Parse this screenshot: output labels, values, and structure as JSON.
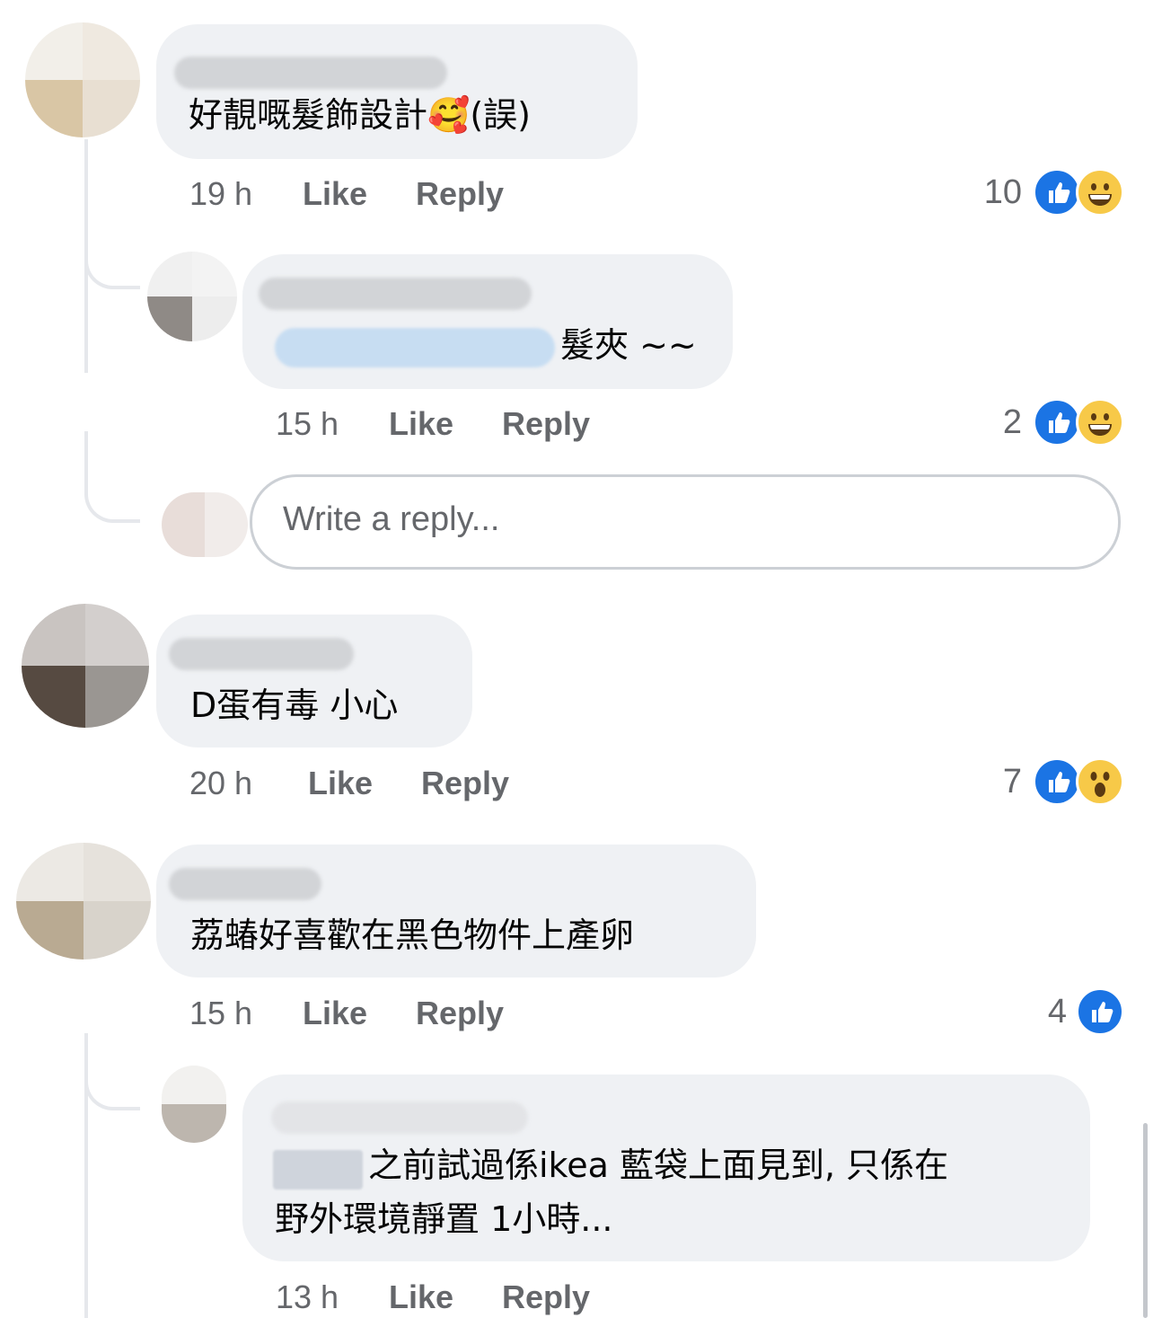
{
  "comments": [
    {
      "text": "好靚嘅髮飾設計🥰(誤)",
      "time": "19 h",
      "like_label": "Like",
      "reply_label": "Reply",
      "reaction_count": "10",
      "reactions": [
        "like-icon",
        "grinning-face-icon"
      ]
    },
    {
      "text_suffix": "髮夾 ~~",
      "time": "15 h",
      "like_label": "Like",
      "reply_label": "Reply",
      "reaction_count": "2",
      "reactions": [
        "like-icon",
        "grinning-face-icon"
      ]
    },
    {
      "text": "D蛋有毒 小心",
      "time": "20 h",
      "like_label": "Like",
      "reply_label": "Reply",
      "reaction_count": "7",
      "reactions": [
        "like-icon",
        "surprised-face-icon"
      ]
    },
    {
      "text": "荔蝽好喜歡在黑色物件上產卵",
      "time": "15 h",
      "like_label": "Like",
      "reply_label": "Reply",
      "reaction_count": "4",
      "reactions": [
        "like-icon"
      ]
    },
    {
      "text_line1": "之前試過係ikea 藍袋上面見到, 只係在",
      "text_line2": "野外環境靜置 1小時...",
      "time": "13 h",
      "like_label": "Like",
      "reply_label": "Reply"
    }
  ],
  "reply_input": {
    "placeholder": "Write a reply..."
  },
  "colors": {
    "bubble": "#eff1f4",
    "meta_text": "#65676b",
    "like_blue": "#1b74e4",
    "reaction_yellow": "#f7c948"
  }
}
